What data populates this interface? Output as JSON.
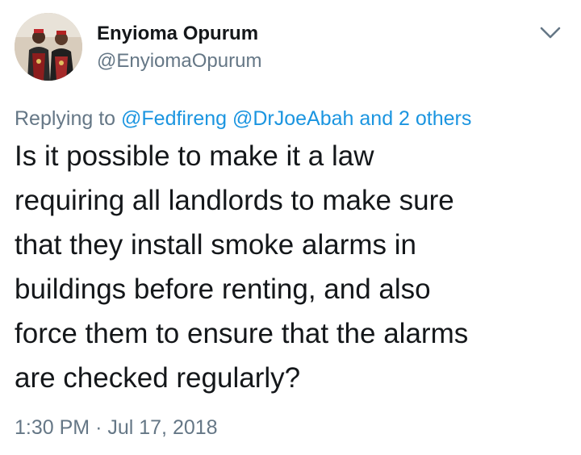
{
  "author": {
    "display_name": "Enyioma Opurum",
    "handle": "@EnyiomaOpurum"
  },
  "reply_context": {
    "prefix": "Replying to",
    "mentions": [
      "@Fedfireng",
      "@DrJoeAbah"
    ],
    "others": "and 2 others"
  },
  "tweet": {
    "text_lines": [
      "Is it possible to make it a law",
      "requiring all landlords to make sure",
      "that they install smoke alarms in",
      "buildings before renting, and also",
      "force them to ensure that the alarms",
      "are checked regularly?"
    ],
    "time": "1:30 PM",
    "separator": "·",
    "date": "Jul 17, 2018"
  },
  "icons": {
    "menu": "chevron-down-icon",
    "avatar": "profile-photo"
  },
  "colors": {
    "text": "#14171a",
    "secondary": "#657786",
    "link": "#1b95e0",
    "background": "#ffffff"
  }
}
